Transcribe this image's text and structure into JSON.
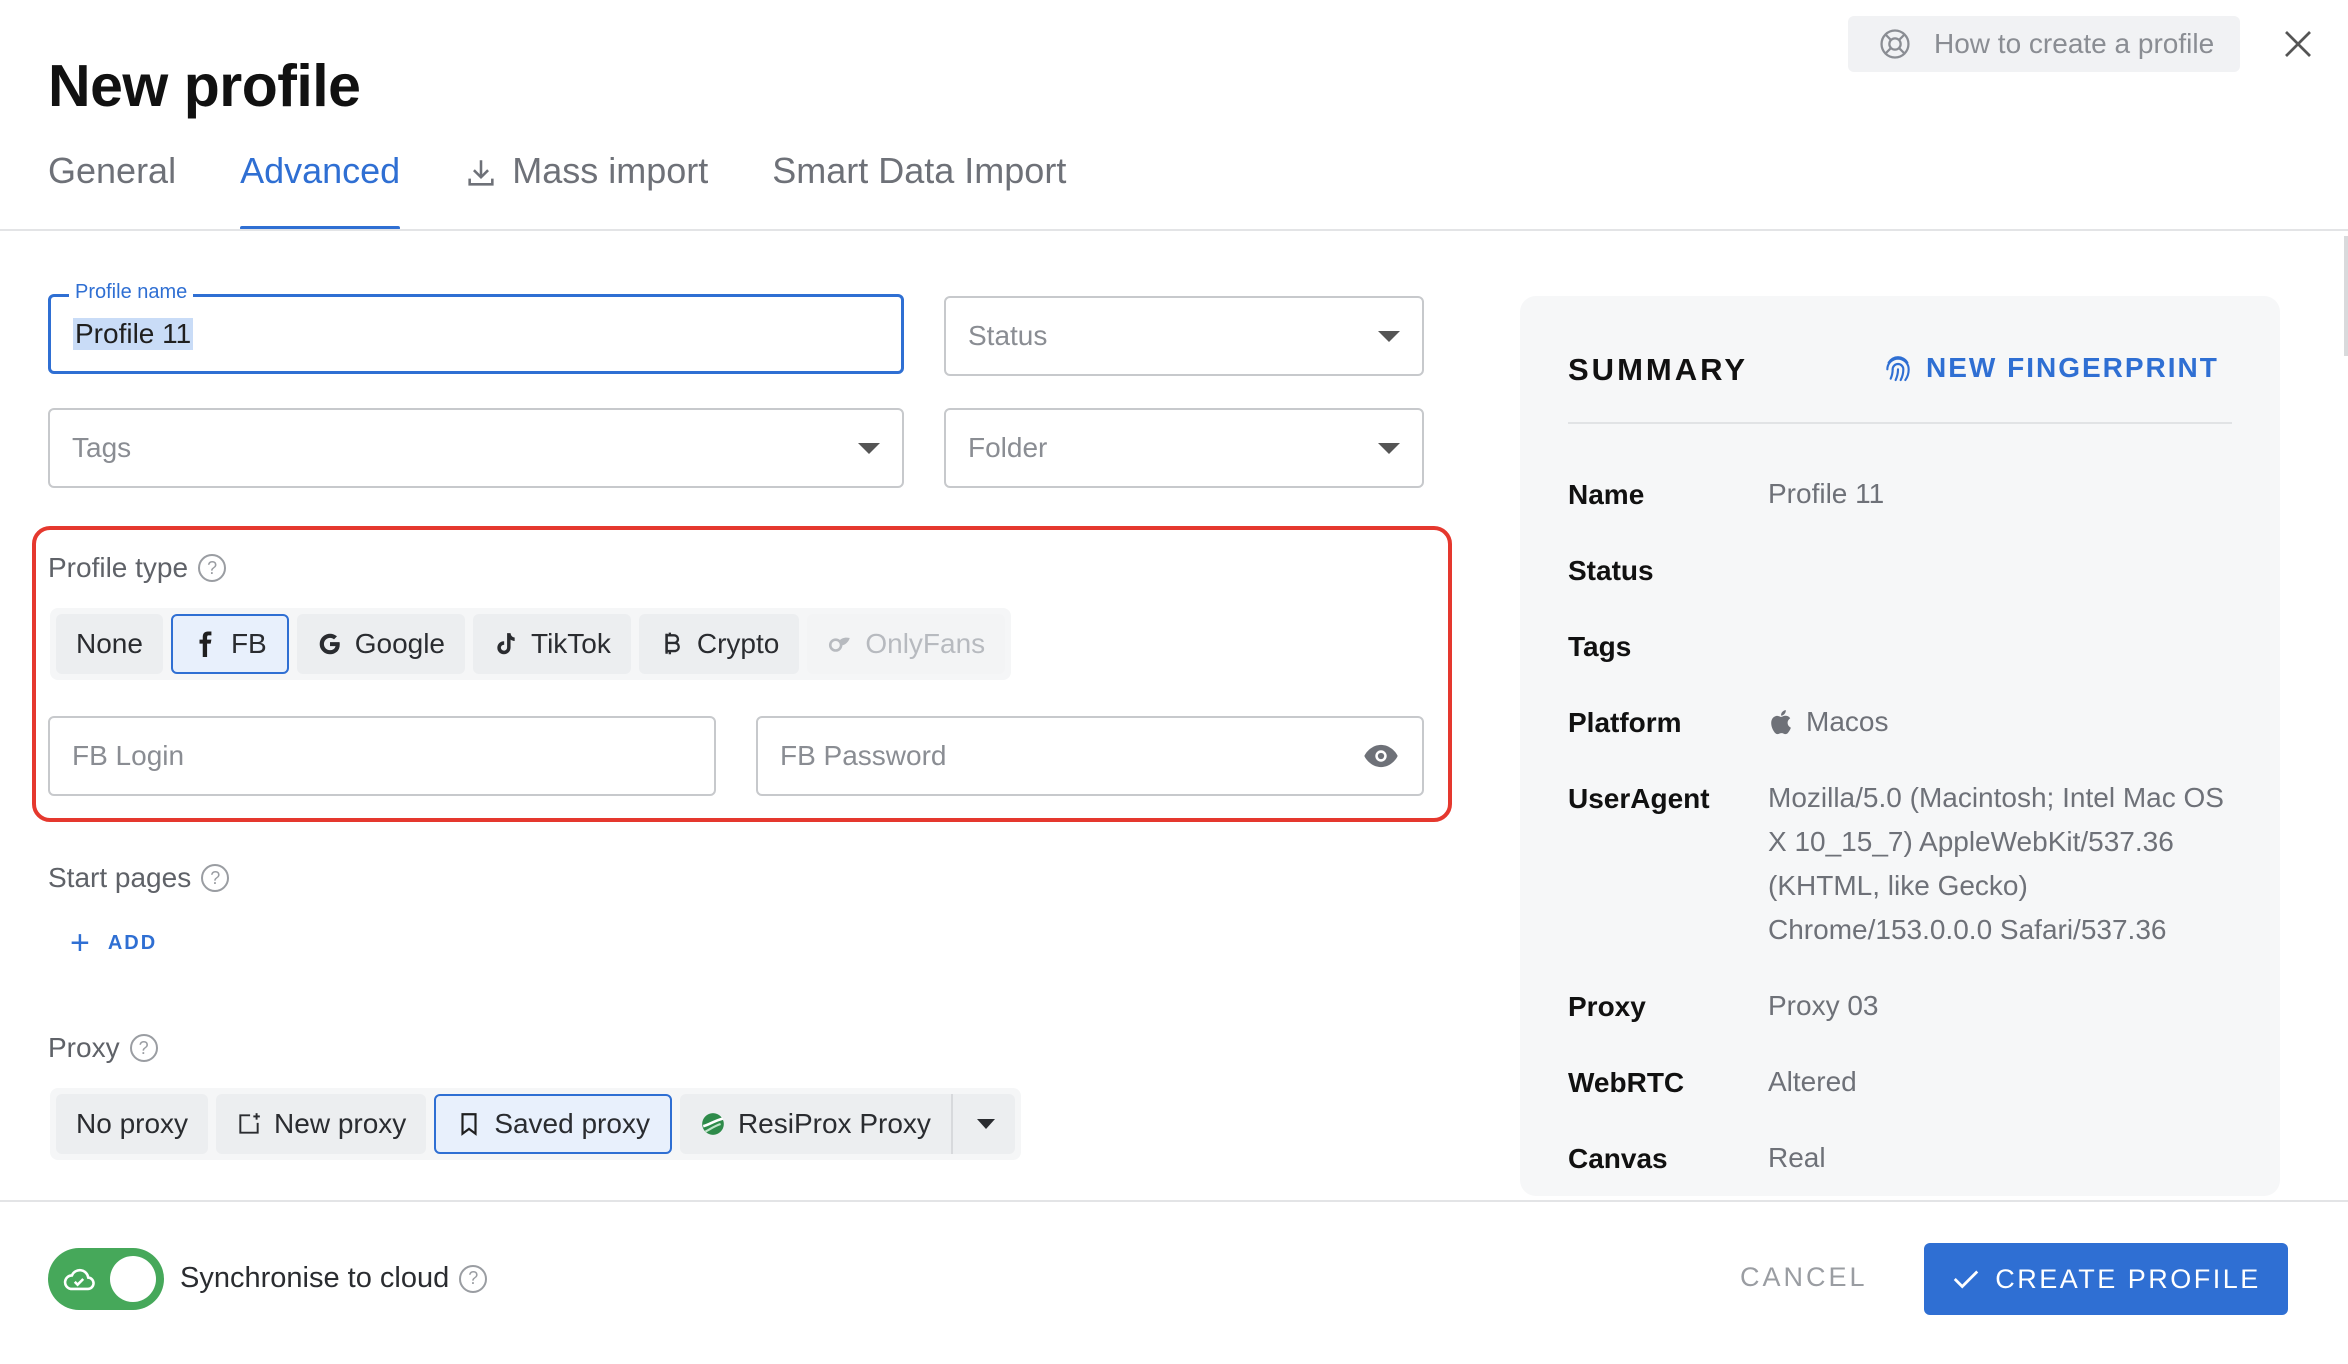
{
  "header": {
    "title": "New profile",
    "help_label": "How to create a profile"
  },
  "tabs": [
    {
      "label": "General",
      "active": false
    },
    {
      "label": "Advanced",
      "active": true
    },
    {
      "label": "Mass import",
      "active": false,
      "icon": "download-icon"
    },
    {
      "label": "Smart Data Import",
      "active": false
    }
  ],
  "form": {
    "profile_name": {
      "label": "Profile name",
      "value": "Profile 11"
    },
    "status": {
      "placeholder": "Status"
    },
    "tags": {
      "placeholder": "Tags"
    },
    "folder": {
      "placeholder": "Folder"
    },
    "profile_type": {
      "label": "Profile type",
      "options": [
        {
          "label": "None",
          "state": "normal"
        },
        {
          "label": "FB",
          "state": "selected",
          "icon": "facebook-icon"
        },
        {
          "label": "Google",
          "state": "normal",
          "icon": "google-icon"
        },
        {
          "label": "TikTok",
          "state": "normal",
          "icon": "tiktok-icon"
        },
        {
          "label": "Crypto",
          "state": "normal",
          "icon": "bitcoin-icon"
        },
        {
          "label": "OnlyFans",
          "state": "disabled",
          "icon": "onlyfans-icon"
        }
      ],
      "login_placeholder": "FB Login",
      "password_placeholder": "FB Password"
    },
    "start_pages": {
      "label": "Start pages",
      "add_label": "ADD"
    },
    "proxy": {
      "label": "Proxy",
      "options": [
        {
          "label": "No proxy",
          "state": "normal"
        },
        {
          "label": "New proxy",
          "state": "normal",
          "icon": "new-proxy-icon"
        },
        {
          "label": "Saved proxy",
          "state": "selected",
          "icon": "bookmark-icon"
        },
        {
          "label": "ResiProx Proxy",
          "state": "normal",
          "icon": "resiprox-icon"
        }
      ]
    }
  },
  "summary": {
    "title": "SUMMARY",
    "fingerprint_label": "NEW FINGERPRINT",
    "rows": [
      {
        "key": "Name",
        "value": "Profile 11"
      },
      {
        "key": "Status",
        "value": ""
      },
      {
        "key": "Tags",
        "value": ""
      },
      {
        "key": "Platform",
        "value": "Macos"
      },
      {
        "key": "UserAgent",
        "value": "Mozilla/5.0 (Macintosh; Intel Mac OS X 10_15_7) AppleWebKit/537.36 (KHTML, like Gecko) Chrome/153.0.0.0 Safari/537.36"
      },
      {
        "key": "Proxy",
        "value": "Proxy 03"
      },
      {
        "key": "WebRTC",
        "value": "Altered"
      },
      {
        "key": "Canvas",
        "value": "Real"
      }
    ]
  },
  "footer": {
    "sync_label": "Synchronise to cloud",
    "sync_enabled": true,
    "cancel_label": "CANCEL",
    "create_label": "CREATE PROFILE"
  },
  "colors": {
    "accent": "#2f6fd3",
    "highlight": "#e5382e",
    "toggle_on": "#46a85a"
  }
}
